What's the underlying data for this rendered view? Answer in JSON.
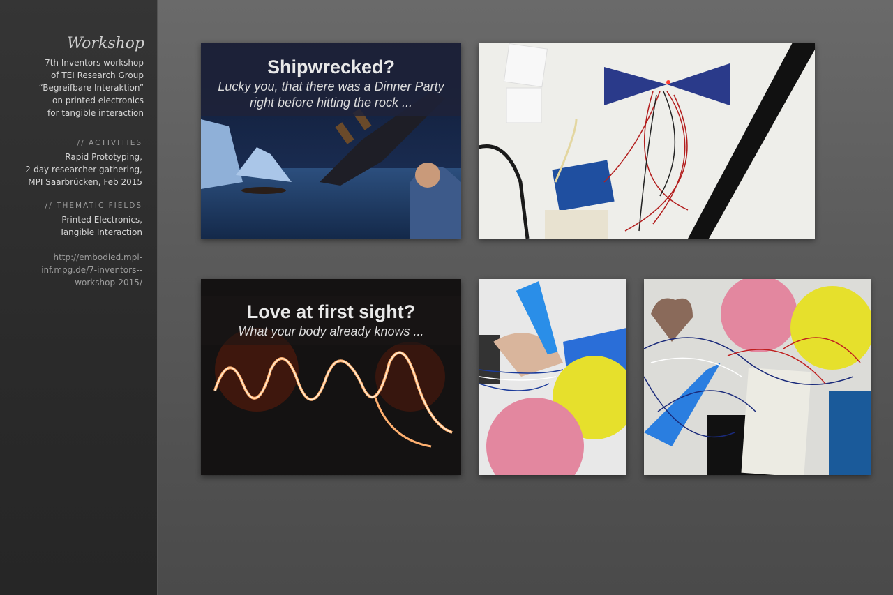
{
  "sidebar": {
    "title": "Workshop",
    "description": [
      "7th Inventors workshop",
      "of TEI Research Group",
      "“Begreifbare Interaktion”",
      "on printed electronics",
      "for tangible interaction"
    ],
    "activities": {
      "heading": "// ACTIVITIES",
      "lines": [
        "Rapid Prototyping,",
        "2-day researcher gathering,",
        "MPI Saarbrücken, Feb 2015"
      ]
    },
    "fields": {
      "heading": "// THEMATIC FIELDS",
      "lines": [
        "Printed Electronics,",
        "Tangible Interaction"
      ]
    },
    "url_lines": [
      "http://embodied.mpi-",
      "inf.mpg.de/7-inventors--",
      "workshop-2015/"
    ]
  },
  "gallery": {
    "shipwreck": {
      "title": "Shipwrecked?",
      "subtitle_1": "Lucky you, that there was a Dinner Party",
      "subtitle_2": "right before hitting the rock ..."
    },
    "love": {
      "title": "Love at first sight?",
      "subtitle": "What your body already knows ..."
    }
  },
  "colors": {
    "sidebar_bg": "#2c2c2c",
    "page_bg": "#5c5c5c",
    "balloon_yellow": "#e8e02a",
    "balloon_pink": "#e58aa5",
    "cone_blue": "#3d8ee0"
  }
}
